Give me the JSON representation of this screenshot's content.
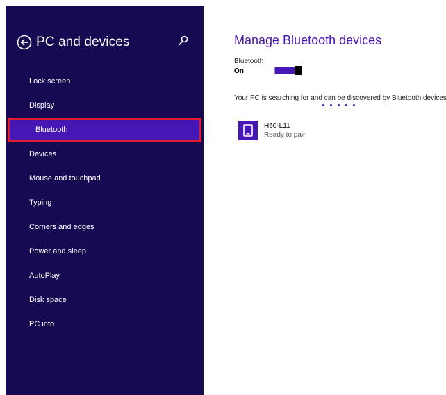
{
  "sidebar": {
    "title": "PC and devices",
    "items": [
      {
        "label": "Lock screen"
      },
      {
        "label": "Display"
      },
      {
        "label": "Bluetooth",
        "selected": true
      },
      {
        "label": "Devices"
      },
      {
        "label": "Mouse and touchpad"
      },
      {
        "label": "Typing"
      },
      {
        "label": "Corners and edges"
      },
      {
        "label": "Power and sleep"
      },
      {
        "label": "AutoPlay"
      },
      {
        "label": "Disk space"
      },
      {
        "label": "PC info"
      }
    ]
  },
  "main": {
    "title": "Manage Bluetooth devices",
    "bluetooth_label": "Bluetooth",
    "bluetooth_state": "On",
    "bluetooth_on": true,
    "status_text": "Your PC is searching for and can be discovered by Bluetooth devices.",
    "devices": [
      {
        "name": "H60-L11",
        "status": "Ready to pair",
        "icon": "phone-icon"
      }
    ]
  },
  "icons": {
    "back": "back-arrow-icon",
    "search": "search-icon"
  },
  "colors": {
    "sidebar_bg": "#180a52",
    "accent": "#4617b4",
    "selection_outline": "#e01b2e"
  }
}
